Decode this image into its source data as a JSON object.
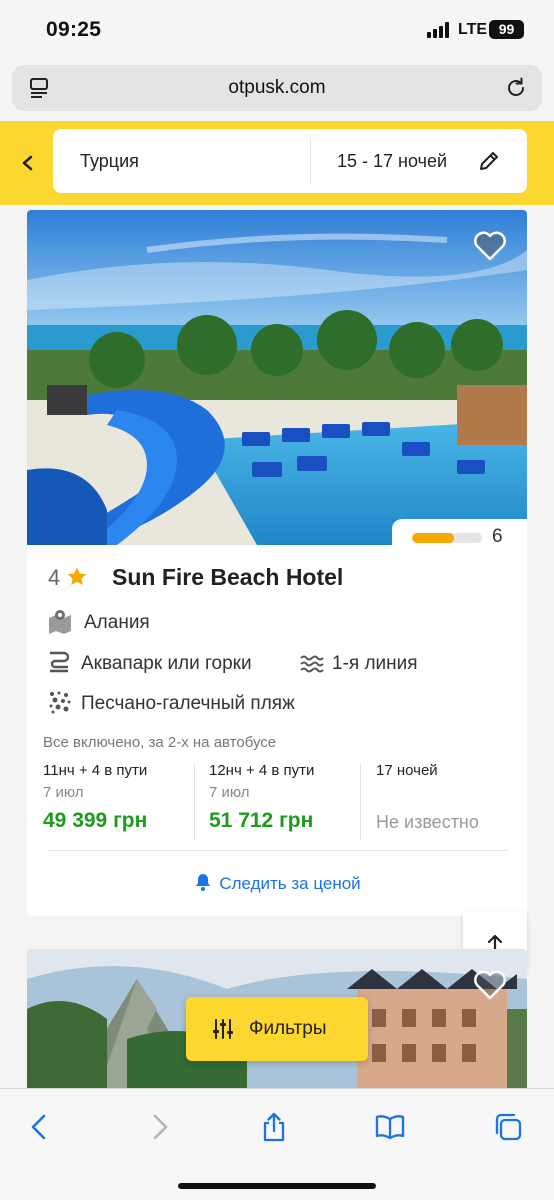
{
  "status": {
    "time": "09:25",
    "network": "LTE",
    "battery": "99"
  },
  "browser": {
    "url": "otpusk.com"
  },
  "search": {
    "country": "Турция",
    "nights": "15 - 17 ночей"
  },
  "hotel": {
    "stars": "4",
    "name": "Sun Fire Beach Hotel",
    "rating": 6,
    "rating_fraction": 0.6,
    "location": "Алания",
    "features": [
      "Аквапарк или горки",
      "1-я линия",
      "Песчано-галечный пляж"
    ],
    "meal_info": "Все включено, за 2-х на автобусе",
    "prices": [
      {
        "duration": "11нч + 4 в пути",
        "date": "7 июл",
        "price": "49 399 грн"
      },
      {
        "duration": "12нч + 4 в пути",
        "date": "7 июл",
        "price": "51 712 грн"
      },
      {
        "duration": "17 ночей",
        "date": "",
        "price": "Не известно"
      }
    ],
    "track_price": "Следить за ценой"
  },
  "filters": {
    "label": "Фильтры"
  },
  "colors": {
    "brand_yellow": "#fcd730",
    "price_green": "#1c9b1c",
    "link_blue": "#1a73e8",
    "rating_orange": "#f5a800"
  }
}
